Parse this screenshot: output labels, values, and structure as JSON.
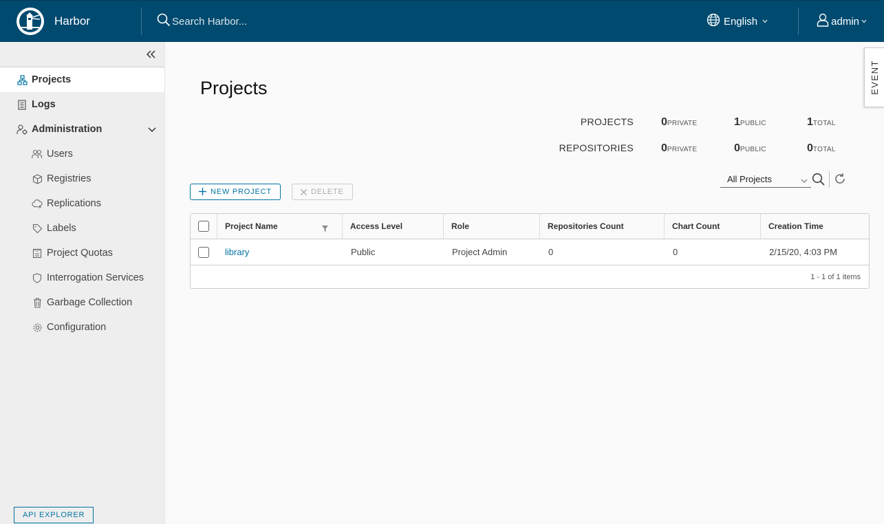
{
  "header": {
    "brand": "Harbor",
    "search_placeholder": "Search Harbor...",
    "language": "English",
    "user": "admin"
  },
  "sidebar": {
    "items": [
      {
        "label": "Projects"
      },
      {
        "label": "Logs"
      },
      {
        "label": "Administration"
      }
    ],
    "admin_items": [
      {
        "label": "Users"
      },
      {
        "label": "Registries"
      },
      {
        "label": "Replications"
      },
      {
        "label": "Labels"
      },
      {
        "label": "Project Quotas"
      },
      {
        "label": "Interrogation Services"
      },
      {
        "label": "Garbage Collection"
      },
      {
        "label": "Configuration"
      }
    ],
    "api_explorer": "API EXPLORER"
  },
  "main": {
    "title": "Projects",
    "summary": {
      "projects_label": "PROJECTS",
      "projects": {
        "private": "0",
        "public": "1",
        "total": "1"
      },
      "repositories_label": "REPOSITORIES",
      "repositories": {
        "private": "0",
        "public": "0",
        "total": "0"
      },
      "units": {
        "private": "PRIVATE",
        "public": "PUBLIC",
        "total": "TOTAL"
      }
    },
    "filter": "All Projects",
    "buttons": {
      "new_project": "NEW PROJECT",
      "delete": "DELETE"
    },
    "table": {
      "columns": [
        "Project Name",
        "Access Level",
        "Role",
        "Repositories Count",
        "Chart Count",
        "Creation Time"
      ],
      "rows": [
        [
          "library",
          "Public",
          "Project Admin",
          "0",
          "0",
          "2/15/20, 4:03 PM"
        ]
      ],
      "footer": "1 - 1 of 1 items"
    }
  },
  "event_tab": "EVENT",
  "colors": {
    "header": "#004a70",
    "accent": "#0072a3"
  }
}
